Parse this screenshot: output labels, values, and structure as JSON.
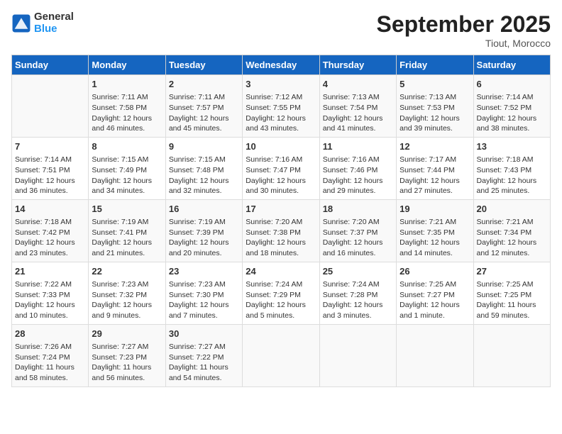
{
  "header": {
    "title": "September 2025",
    "subtitle": "Tiout, Morocco",
    "logo_line1": "General",
    "logo_line2": "Blue"
  },
  "weekdays": [
    "Sunday",
    "Monday",
    "Tuesday",
    "Wednesday",
    "Thursday",
    "Friday",
    "Saturday"
  ],
  "weeks": [
    [
      {
        "day": "",
        "info": ""
      },
      {
        "day": "1",
        "info": "Sunrise: 7:11 AM\nSunset: 7:58 PM\nDaylight: 12 hours and 46 minutes."
      },
      {
        "day": "2",
        "info": "Sunrise: 7:11 AM\nSunset: 7:57 PM\nDaylight: 12 hours and 45 minutes."
      },
      {
        "day": "3",
        "info": "Sunrise: 7:12 AM\nSunset: 7:55 PM\nDaylight: 12 hours and 43 minutes."
      },
      {
        "day": "4",
        "info": "Sunrise: 7:13 AM\nSunset: 7:54 PM\nDaylight: 12 hours and 41 minutes."
      },
      {
        "day": "5",
        "info": "Sunrise: 7:13 AM\nSunset: 7:53 PM\nDaylight: 12 hours and 39 minutes."
      },
      {
        "day": "6",
        "info": "Sunrise: 7:14 AM\nSunset: 7:52 PM\nDaylight: 12 hours and 38 minutes."
      }
    ],
    [
      {
        "day": "7",
        "info": "Sunrise: 7:14 AM\nSunset: 7:51 PM\nDaylight: 12 hours and 36 minutes."
      },
      {
        "day": "8",
        "info": "Sunrise: 7:15 AM\nSunset: 7:49 PM\nDaylight: 12 hours and 34 minutes."
      },
      {
        "day": "9",
        "info": "Sunrise: 7:15 AM\nSunset: 7:48 PM\nDaylight: 12 hours and 32 minutes."
      },
      {
        "day": "10",
        "info": "Sunrise: 7:16 AM\nSunset: 7:47 PM\nDaylight: 12 hours and 30 minutes."
      },
      {
        "day": "11",
        "info": "Sunrise: 7:16 AM\nSunset: 7:46 PM\nDaylight: 12 hours and 29 minutes."
      },
      {
        "day": "12",
        "info": "Sunrise: 7:17 AM\nSunset: 7:44 PM\nDaylight: 12 hours and 27 minutes."
      },
      {
        "day": "13",
        "info": "Sunrise: 7:18 AM\nSunset: 7:43 PM\nDaylight: 12 hours and 25 minutes."
      }
    ],
    [
      {
        "day": "14",
        "info": "Sunrise: 7:18 AM\nSunset: 7:42 PM\nDaylight: 12 hours and 23 minutes."
      },
      {
        "day": "15",
        "info": "Sunrise: 7:19 AM\nSunset: 7:41 PM\nDaylight: 12 hours and 21 minutes."
      },
      {
        "day": "16",
        "info": "Sunrise: 7:19 AM\nSunset: 7:39 PM\nDaylight: 12 hours and 20 minutes."
      },
      {
        "day": "17",
        "info": "Sunrise: 7:20 AM\nSunset: 7:38 PM\nDaylight: 12 hours and 18 minutes."
      },
      {
        "day": "18",
        "info": "Sunrise: 7:20 AM\nSunset: 7:37 PM\nDaylight: 12 hours and 16 minutes."
      },
      {
        "day": "19",
        "info": "Sunrise: 7:21 AM\nSunset: 7:35 PM\nDaylight: 12 hours and 14 minutes."
      },
      {
        "day": "20",
        "info": "Sunrise: 7:21 AM\nSunset: 7:34 PM\nDaylight: 12 hours and 12 minutes."
      }
    ],
    [
      {
        "day": "21",
        "info": "Sunrise: 7:22 AM\nSunset: 7:33 PM\nDaylight: 12 hours and 10 minutes."
      },
      {
        "day": "22",
        "info": "Sunrise: 7:23 AM\nSunset: 7:32 PM\nDaylight: 12 hours and 9 minutes."
      },
      {
        "day": "23",
        "info": "Sunrise: 7:23 AM\nSunset: 7:30 PM\nDaylight: 12 hours and 7 minutes."
      },
      {
        "day": "24",
        "info": "Sunrise: 7:24 AM\nSunset: 7:29 PM\nDaylight: 12 hours and 5 minutes."
      },
      {
        "day": "25",
        "info": "Sunrise: 7:24 AM\nSunset: 7:28 PM\nDaylight: 12 hours and 3 minutes."
      },
      {
        "day": "26",
        "info": "Sunrise: 7:25 AM\nSunset: 7:27 PM\nDaylight: 12 hours and 1 minute."
      },
      {
        "day": "27",
        "info": "Sunrise: 7:25 AM\nSunset: 7:25 PM\nDaylight: 11 hours and 59 minutes."
      }
    ],
    [
      {
        "day": "28",
        "info": "Sunrise: 7:26 AM\nSunset: 7:24 PM\nDaylight: 11 hours and 58 minutes."
      },
      {
        "day": "29",
        "info": "Sunrise: 7:27 AM\nSunset: 7:23 PM\nDaylight: 11 hours and 56 minutes."
      },
      {
        "day": "30",
        "info": "Sunrise: 7:27 AM\nSunset: 7:22 PM\nDaylight: 11 hours and 54 minutes."
      },
      {
        "day": "",
        "info": ""
      },
      {
        "day": "",
        "info": ""
      },
      {
        "day": "",
        "info": ""
      },
      {
        "day": "",
        "info": ""
      }
    ]
  ]
}
